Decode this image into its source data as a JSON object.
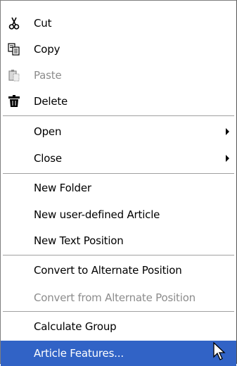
{
  "menu": {
    "items": [
      {
        "label": "Cut",
        "icon": "scissors-icon",
        "enabled": true
      },
      {
        "label": "Copy",
        "icon": "copy-icon",
        "enabled": true
      },
      {
        "label": "Paste",
        "icon": "paste-icon",
        "enabled": false
      },
      {
        "label": "Delete",
        "icon": "trash-icon",
        "enabled": true
      },
      {
        "label": "Open",
        "submenu": true,
        "enabled": true
      },
      {
        "label": "Close",
        "submenu": true,
        "enabled": true
      },
      {
        "label": "New Folder",
        "enabled": true
      },
      {
        "label": "New user-defined Article",
        "enabled": true
      },
      {
        "label": "New Text Position",
        "enabled": true
      },
      {
        "label": "Convert to Alternate Position",
        "enabled": true
      },
      {
        "label": "Convert from Alternate Position",
        "enabled": false
      },
      {
        "label": "Calculate Group",
        "enabled": true
      },
      {
        "label": "Article Features...",
        "enabled": true,
        "selected": true
      }
    ]
  },
  "colors": {
    "highlight": "#3163c6",
    "disabled_text": "#8c8c8c",
    "text": "#000000"
  }
}
